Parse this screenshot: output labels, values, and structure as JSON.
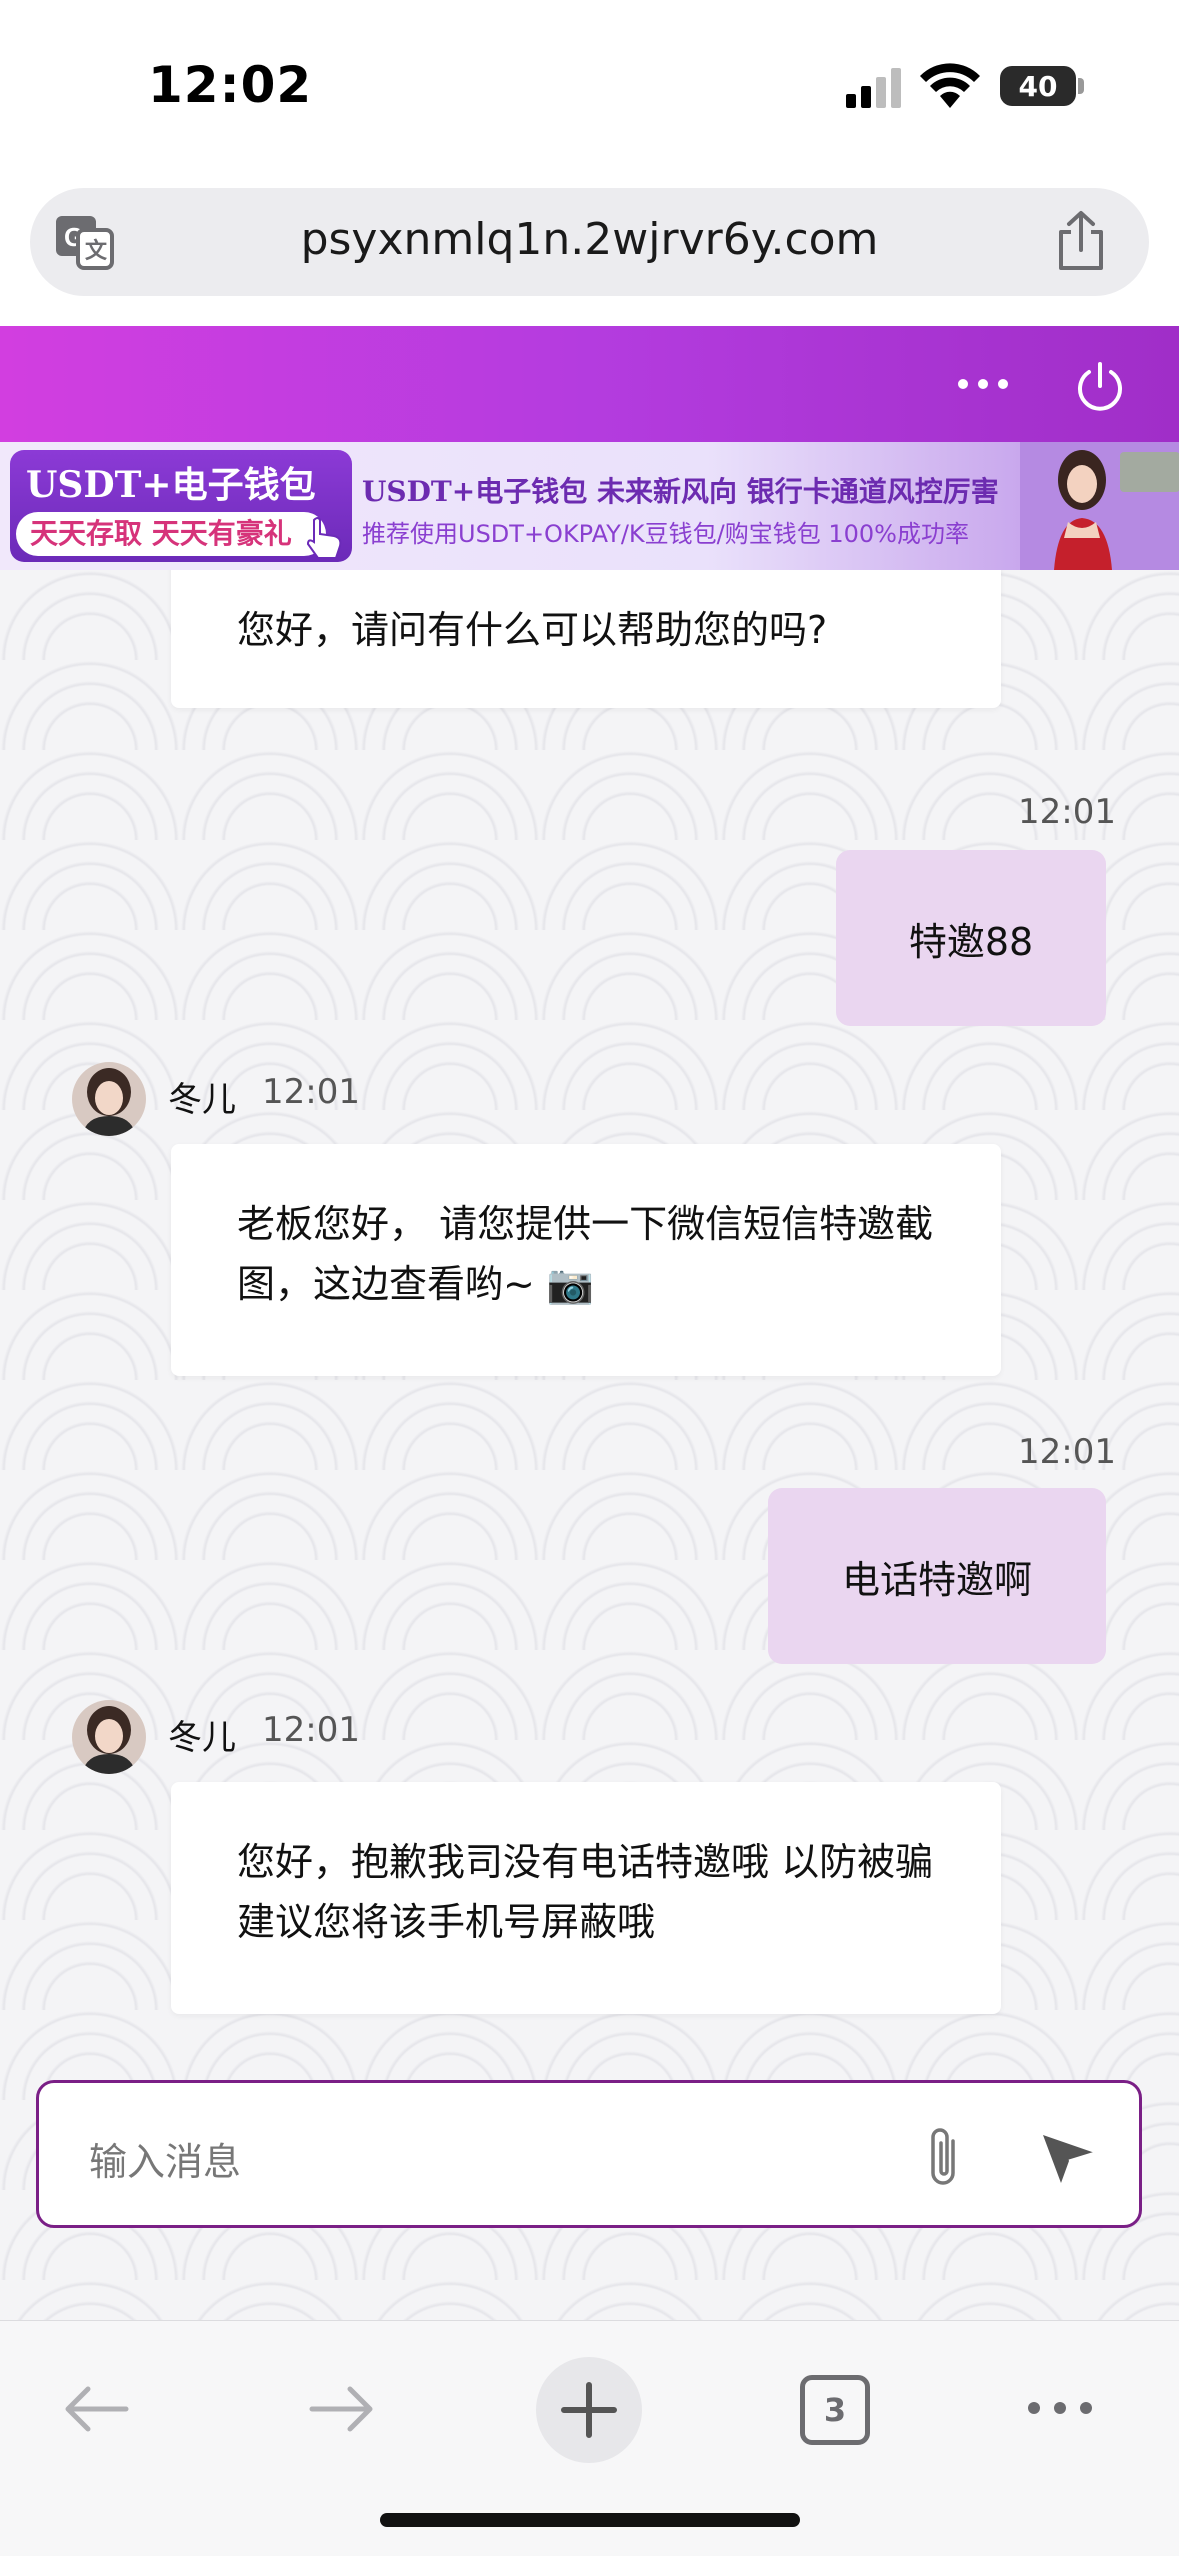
{
  "status_bar": {
    "time": "12:02",
    "battery": "40"
  },
  "browser": {
    "url": "psyxnmlq1n.2wjrvr6y.com",
    "tab_count": "3"
  },
  "banner": {
    "left_top": "USDT+电子钱包",
    "left_bottom": "天天存取 天天有豪礼",
    "line1": "USDT+电子钱包  未来新风向  银行卡通道风控厉害",
    "line2": "推荐使用USDT+OKPAY/K豆钱包/购宝钱包   100%成功率"
  },
  "messages": [
    {
      "type": "agent",
      "text": "您好，请问有什么可以帮助您的吗?"
    },
    {
      "type": "mine",
      "time": "12:01",
      "text": "特邀88"
    },
    {
      "type": "agent",
      "sender": "冬儿",
      "time": "12:01",
      "text": "老板您好， 请您提供一下微信短信特邀截图，这边查看哟~ 📷"
    },
    {
      "type": "mine",
      "time": "12:01",
      "text": "电话特邀啊"
    },
    {
      "type": "agent",
      "sender": "冬儿",
      "time": "12:01",
      "text": "您好，抱歉我司没有电话特邀哦 以防被骗 建议您将该手机号屏蔽哦"
    }
  ],
  "composer": {
    "placeholder": "输入消息"
  },
  "colors": {
    "header_gradient_start": "#d23ee0",
    "mine_bubble": "#ead6f0",
    "input_border": "#7a1f86"
  },
  "icons": [
    "translate-icon",
    "share-icon",
    "more-icon",
    "power-icon",
    "paperclip-icon",
    "send-icon",
    "back-arrow-icon",
    "forward-arrow-icon",
    "plus-icon",
    "more-dots-icon"
  ]
}
